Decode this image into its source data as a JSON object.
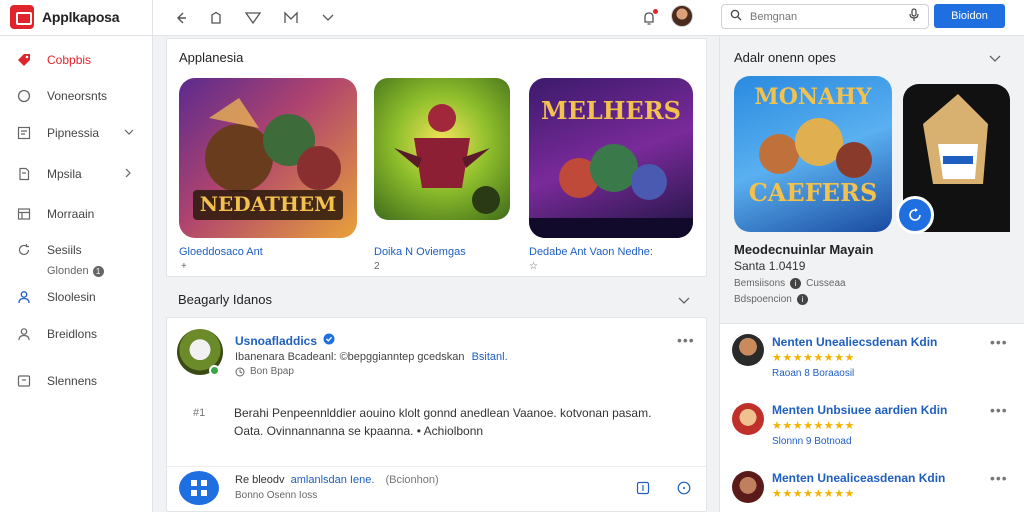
{
  "brand": {
    "name": "Applkaposa"
  },
  "search": {
    "placeholder": "Bemgnan",
    "button": "Bioidon"
  },
  "sidebar": {
    "items": [
      {
        "label": "Cobpbis",
        "icon": "tag-icon"
      },
      {
        "label": "Voneorsnts",
        "icon": "circle-icon"
      },
      {
        "label": "Pipnessia",
        "icon": "grid-icon"
      },
      {
        "label": "Mpsila",
        "icon": "document-icon"
      },
      {
        "label": "Morraain",
        "icon": "table-icon"
      },
      {
        "label": "Sesiils",
        "icon": "refresh-icon"
      },
      {
        "label": "Sloolesin",
        "icon": "user-icon"
      },
      {
        "label": "Breidlons",
        "icon": "person-icon"
      },
      {
        "label": "Slennens",
        "icon": "archive-icon"
      }
    ],
    "sub_label": "Glonden",
    "sub_badge": "1"
  },
  "apps_section": {
    "title": "Applanesia",
    "tiles": [
      {
        "caption": "Gloeddosaco Ant",
        "sub": "+",
        "art_text": "NEDATHEM"
      },
      {
        "caption": "Doika N Oviemgas",
        "sub": "2",
        "art_text": ""
      },
      {
        "caption": "Dedabe Ant Vaon Nedhe:",
        "sub": "☆",
        "art_text": "MELHERS"
      }
    ]
  },
  "feed_section": {
    "title": "Beagarly Idanos",
    "post": {
      "name": "Usnoafladdics",
      "line1": "Ibanenara Bcadeanl: ©bepggianntep gcedskan",
      "line1_link": "Bsitanl.",
      "meta": "Bon Bpap",
      "line2": "Berahi Penpeennlddier aouino klolt gonnd anedlean Vaanoe. kotvonan pasam.",
      "line3": "Oata. Ovinnannanna se kpaanna. • Achiolbonn",
      "line2_icon": "#1",
      "footer_name": "Re bleodv",
      "footer_link": "amlanlsdan Iene.",
      "footer_paren": "(Bcionhon)",
      "footer_meta": "Bonno  Osenn  Ioss"
    }
  },
  "right_panel": {
    "title": "Adalr onenn opes",
    "featured": {
      "art_text_top": "MONAHY",
      "art_text_bottom": "CAEFERS",
      "title": "Meodecnuinlar Mayain",
      "subtitle": "Santa 1.0419",
      "sub_meta": "Bemsiisons",
      "sub_meta_suffix": "Cusseaa",
      "sub_meta2": "Bdspoencion"
    },
    "reviews": [
      {
        "name": "Nenten Unealiecsdenan Kdin",
        "stars": "★★★★★★★★",
        "meta": "Raoan  8 Boraaosil"
      },
      {
        "name": "Menten Unbsiuee aardien Kdin",
        "stars": "★★★★★★★★",
        "meta": "Slonnn  9 Botnoad"
      },
      {
        "name": "Menten Unealiceasdenan Kdin",
        "stars": "★★★★★★★★",
        "meta": ""
      }
    ]
  },
  "colors": {
    "accent": "#1f6fe0",
    "brand": "#e0242c",
    "link": "#1f5fc0"
  }
}
